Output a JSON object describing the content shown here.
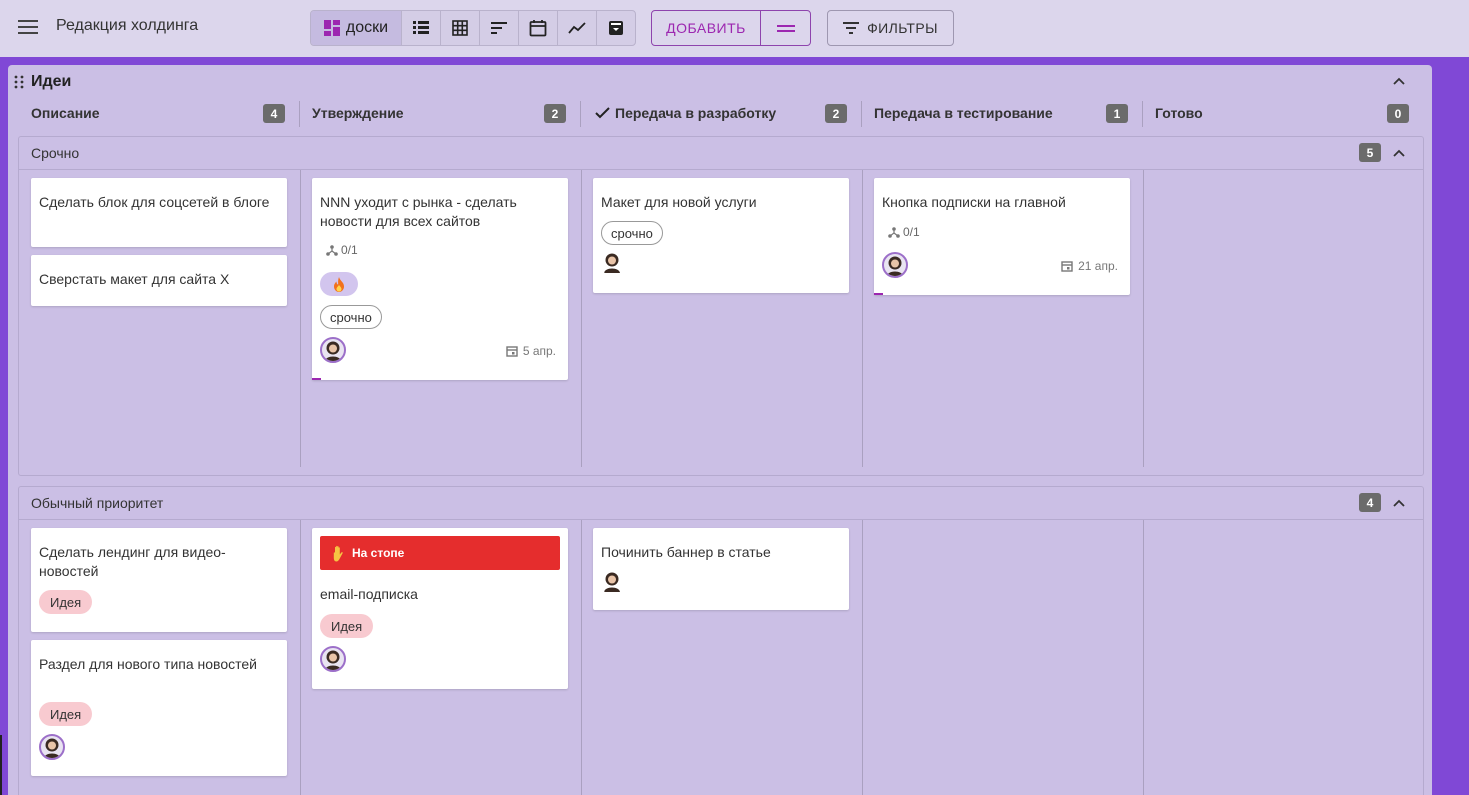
{
  "app": {
    "title": "Редакция холдинга"
  },
  "toolbar": {
    "boards_label": "доски",
    "add_label": "ДОБАВИТЬ",
    "filters_label": "ФИЛЬТРЫ",
    "view_icons": [
      "list-icon",
      "table-icon",
      "gantt-icon",
      "calendar-icon",
      "chart-icon",
      "archive-icon"
    ]
  },
  "colors": {
    "accent": "#9c27b0",
    "background": "#8048d6",
    "board": "#cbbfe5",
    "stop": "#e52d2d",
    "idea_tag": "#f8cad0"
  },
  "board": {
    "title": "Идеи",
    "columns": [
      {
        "label": "Описание",
        "count": "4"
      },
      {
        "label": "Утверждение",
        "count": "2"
      },
      {
        "label": "Передача в разработку",
        "count": "2"
      },
      {
        "label": "Передача в тестирование",
        "count": "1"
      },
      {
        "label": "Готово",
        "count": "0"
      }
    ],
    "lanes": [
      {
        "title": "Срочно",
        "count": "5",
        "cards": {
          "c1": {
            "title": "Сделать блок для соцсетей в блоге"
          },
          "c2": {
            "title": "Сверстать макет для сайта Х"
          },
          "c3": {
            "title": "NNN уходит с рынка - сделать новости для всех сайтов",
            "subtasks": "0/1",
            "tag": "срочно",
            "due": "5 апр."
          },
          "c4": {
            "title": "Макет для новой услуги",
            "tag": "срочно"
          },
          "c5": {
            "title": "Кнопка подписки на главной",
            "subtasks": "0/1",
            "due": "21 апр."
          }
        }
      },
      {
        "title": "Обычный приоритет",
        "count": "4",
        "cards": {
          "c1": {
            "title": "Сделать лендинг для видео-новостей",
            "tag": "Идея"
          },
          "c2": {
            "title": "Раздел для нового типа новостей",
            "tag": "Идея"
          },
          "c3": {
            "stop_label": "На стопе",
            "title": "email-подписка",
            "tag": "Идея"
          },
          "c4": {
            "title": "Починить баннер в статье"
          }
        }
      }
    ]
  }
}
